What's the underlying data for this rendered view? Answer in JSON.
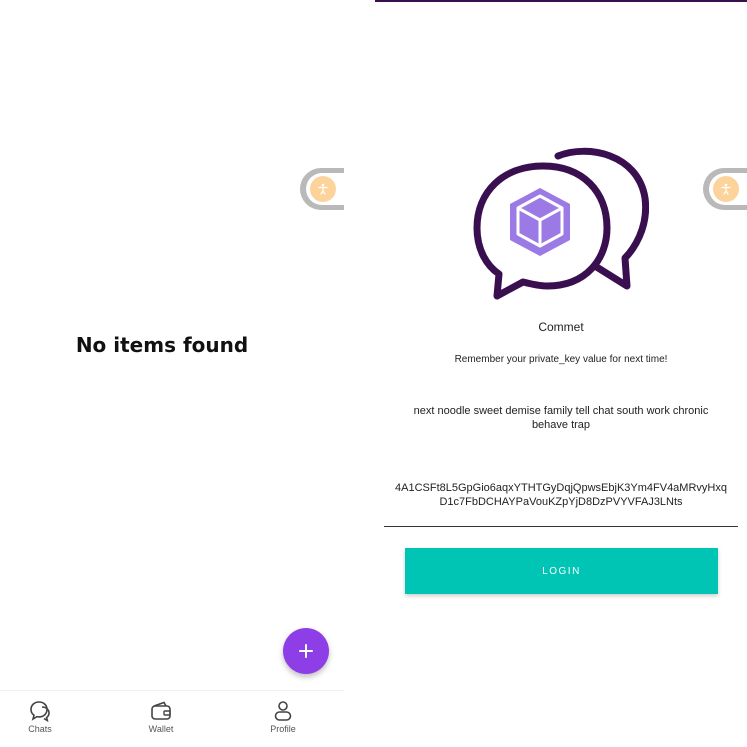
{
  "left_screen": {
    "empty_message": "No items found",
    "fab_icon": "plus-icon",
    "bottom_nav": [
      {
        "label": "Chats",
        "icon": "chat-bubbles-icon"
      },
      {
        "label": "Wallet",
        "icon": "wallet-icon"
      },
      {
        "label": "Profile",
        "icon": "person-icon"
      }
    ],
    "accessibility_icon": "accessibility-icon"
  },
  "right_screen": {
    "app_name": "Commet",
    "reminder": "Remember your private_key value for next time!",
    "mnemonic": "next noodle sweet demise family tell chat south work chronic behave trap",
    "private_key": "4A1CSFt8L5GpGio6aqxYTHTGyDqjQpwsEbjK3Ym4FV4aMRvyHxqD1c7FbDCHAYPaVouKZpYjD8DzPVYVFAJ3LNts",
    "login_label": "LOGIN",
    "accessibility_icon": "accessibility-icon"
  },
  "colors": {
    "fab": "#8e3ee6",
    "login_button": "#00c4b4",
    "logo_dark": "#3a0f4f",
    "logo_cube": "#9b7ae6",
    "accessibility_badge": "#fcd49b"
  }
}
